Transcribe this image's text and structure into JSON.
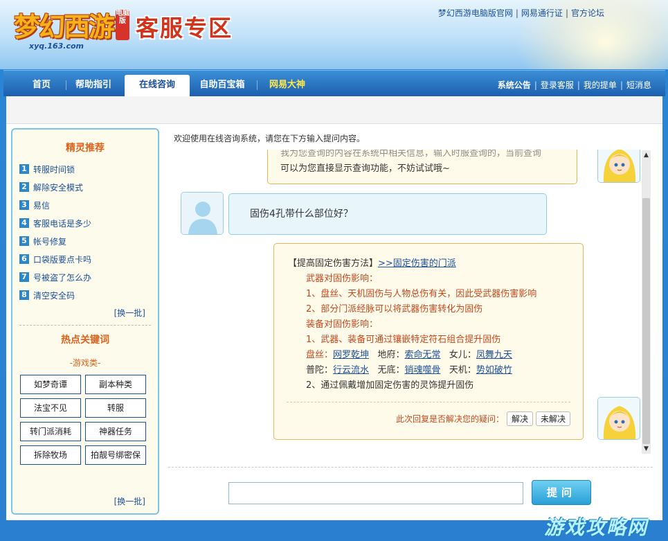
{
  "header": {
    "logo_text": "梦幻西游",
    "logo_badge": "电脑版",
    "logo_url": "xyq.163.com",
    "zone_title": "客服专区",
    "top_links": [
      "梦幻西游电脑版官网",
      "网易通行证",
      "官方论坛"
    ]
  },
  "nav": {
    "tabs": [
      {
        "label": "首页"
      },
      {
        "label": "帮助指引"
      },
      {
        "label": "在线咨询"
      },
      {
        "label": "自助百宝箱"
      },
      {
        "label": "网易大神"
      }
    ],
    "right_links": [
      "系统公告",
      "登录客服",
      "我的提单",
      "短消息"
    ]
  },
  "sidebar": {
    "recommend_title": "精灵推荐",
    "items": [
      {
        "num": "1",
        "label": "转服时间锁"
      },
      {
        "num": "2",
        "label": "解除安全模式"
      },
      {
        "num": "3",
        "label": "易信"
      },
      {
        "num": "4",
        "label": "客服电话是多少"
      },
      {
        "num": "5",
        "label": "帐号修复"
      },
      {
        "num": "6",
        "label": "口袋版要点卡吗"
      },
      {
        "num": "7",
        "label": "号被盗了怎么办"
      },
      {
        "num": "8",
        "label": "清空安全码"
      }
    ],
    "refresh_label": "[换一批]",
    "hot_title": "热点关键词",
    "category_label": "-游戏类-",
    "keywords": [
      "如梦奇谭",
      "副本种类",
      "法宝不见",
      "转服",
      "转门派消耗",
      "神器任务",
      "拆除牧场",
      "拍靓号绑密保"
    ],
    "refresh_label_2": "[换一批]"
  },
  "chat": {
    "welcome": "欢迎使用在线咨询系统，请您在下方输入提问内容。",
    "prev_reply_partial": "我为您查询的内容在系统中相关信息，输入时服查询的，当前查询",
    "prev_reply_last": "可以为您直接显示查询功能，不妨试试哦~",
    "user_question": "固伤4孔带什么部位好？",
    "answer": {
      "title_prefix": "【提高固定伤害方法】",
      "title_link": ">>固定伤害的门派",
      "weapon_heading": "武器对固伤影响：",
      "weapon_1": "1、盘丝、天机固伤与人物总伤有关，因此受武器伤害影响",
      "weapon_2": "2、部分门派经脉可以将武器伤害转化为固伤",
      "equip_heading": "装备对固伤影响：",
      "equip_1": "1、武器、装备可通过镶嵌特定符石组合提升固伤",
      "pansi_label": "盘丝：",
      "pansi_link": "网罗乾坤",
      "difu_label": "地府：",
      "difu_link": "索命无常",
      "nver_label": "女儿：",
      "nver_link": "凤舞九天",
      "putuo_label": "普陀：",
      "putuo_link": "行云流水",
      "wudi_label": "无底：",
      "wudi_link": "销魂噬骨",
      "tianji_label": "天机：",
      "tianji_link": "势如破竹",
      "equip_2": "2、通过佩戴增加固定伤害的灵饰提升固伤",
      "feedback_question": "此次回复是否解决您的疑问：",
      "resolved": "解决",
      "unresolved": "未解决"
    }
  },
  "input": {
    "placeholder": "",
    "submit_label": "提问"
  },
  "watermark": "游戏攻略网"
}
